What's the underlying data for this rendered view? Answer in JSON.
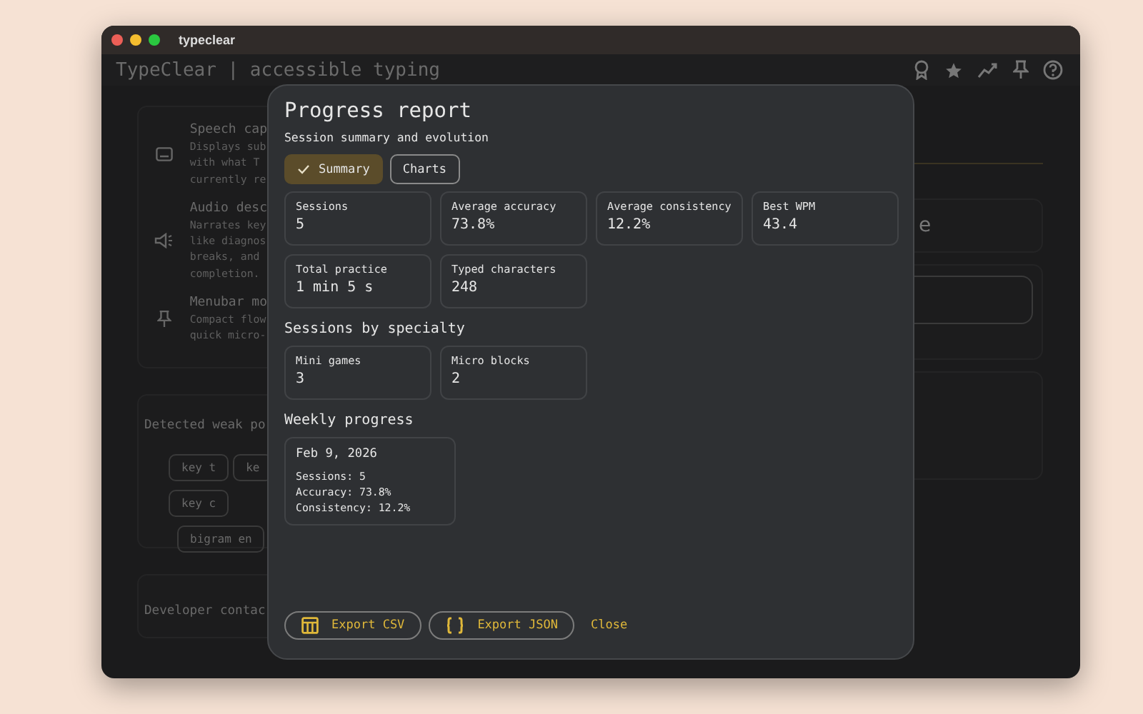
{
  "window": {
    "title": "typeclear"
  },
  "header": {
    "title": "TypeClear | accessible typing"
  },
  "features": [
    {
      "kind": "captions",
      "title": "Speech cap",
      "lines": [
        "Displays sub",
        "with what T",
        "currently re"
      ]
    },
    {
      "kind": "megaphone",
      "title": "Audio desc",
      "lines": [
        "Narrates key",
        "like diagnos",
        "breaks, and",
        "completion."
      ]
    },
    {
      "kind": "pin",
      "title": "Menubar mo",
      "lines": [
        "Compact flow",
        "quick micro-"
      ]
    }
  ],
  "weak_points": {
    "title": "Detected weak po",
    "chips": [
      [
        "key t",
        "ke"
      ],
      [
        "key c"
      ],
      [
        "bigram en"
      ]
    ]
  },
  "developer": {
    "title": "Developer contac"
  },
  "right_card": {
    "text": "e"
  },
  "dialog": {
    "title": "Progress report",
    "subtitle": "Session summary and evolution",
    "tabs": [
      {
        "label": "Summary",
        "selected": true
      },
      {
        "label": "Charts",
        "selected": false
      }
    ],
    "stats": [
      {
        "label": "Sessions",
        "value": "5"
      },
      {
        "label": "Average accuracy",
        "value": "73.8%"
      },
      {
        "label": "Average consistency",
        "value": "12.2%"
      },
      {
        "label": "Best WPM",
        "value": "43.4"
      },
      {
        "label": "Total practice",
        "value": "1 min 5 s"
      },
      {
        "label": "Typed characters",
        "value": "248"
      }
    ],
    "specialty_heading": "Sessions by specialty",
    "specialty": [
      {
        "label": "Mini games",
        "value": "3"
      },
      {
        "label": "Micro blocks",
        "value": "2"
      }
    ],
    "weekly_heading": "Weekly progress",
    "weekly": [
      {
        "date": "Feb 9, 2026",
        "lines": [
          "Sessions: 5",
          "Accuracy: 73.8%",
          "Consistency: 12.2%"
        ]
      }
    ],
    "buttons": [
      {
        "kind": "csv",
        "label": "Export CSV"
      },
      {
        "kind": "json",
        "label": "Export JSON"
      },
      {
        "kind": "text",
        "label": "Close"
      }
    ]
  }
}
